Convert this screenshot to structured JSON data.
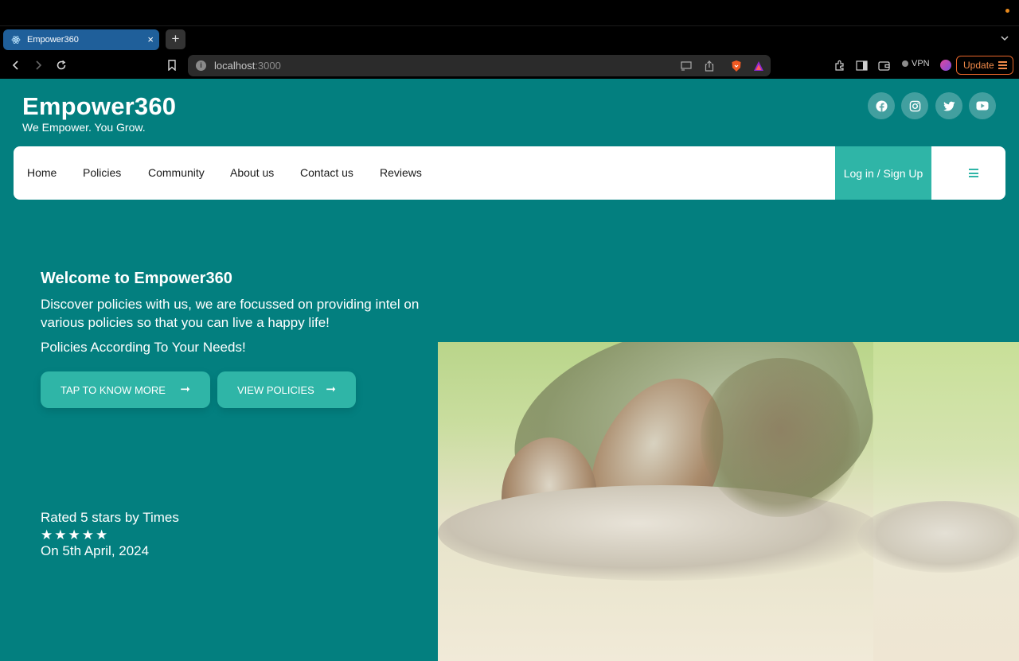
{
  "browser": {
    "tab_title": "Empower360",
    "tab_close": "×",
    "new_tab": "+",
    "url_host": "localhost",
    "url_port": ":3000",
    "vpn_label": "VPN",
    "update_label": "Update"
  },
  "header": {
    "brand": "Empower360",
    "tagline": "We Empower. You Grow.",
    "social": [
      "facebook-icon",
      "instagram-icon",
      "twitter-icon",
      "youtube-icon"
    ]
  },
  "nav": {
    "items": [
      "Home",
      "Policies",
      "Community",
      "About us",
      "Contact us",
      "Reviews"
    ],
    "login": "Log in / Sign Up"
  },
  "hero": {
    "title": "Welcome to Empower360",
    "description": "Discover policies with us, we are focussed on providing intel on various policies so that you can live a happy life!",
    "subtitle": "Policies According To Your Needs!",
    "cta_primary": "TAP TO KNOW MORE",
    "cta_secondary": "VIEW POLICIES",
    "arrow": "➞"
  },
  "rating": {
    "label": "Rated 5 stars by Times",
    "stars": 5,
    "stars_text": "★★★★★",
    "date": "On 5th April, 2024"
  },
  "colors": {
    "page_bg": "#037f7f",
    "accent": "#2fb5a7",
    "tab_active": "#1f5f9a",
    "update_orange": "#e8672a"
  }
}
